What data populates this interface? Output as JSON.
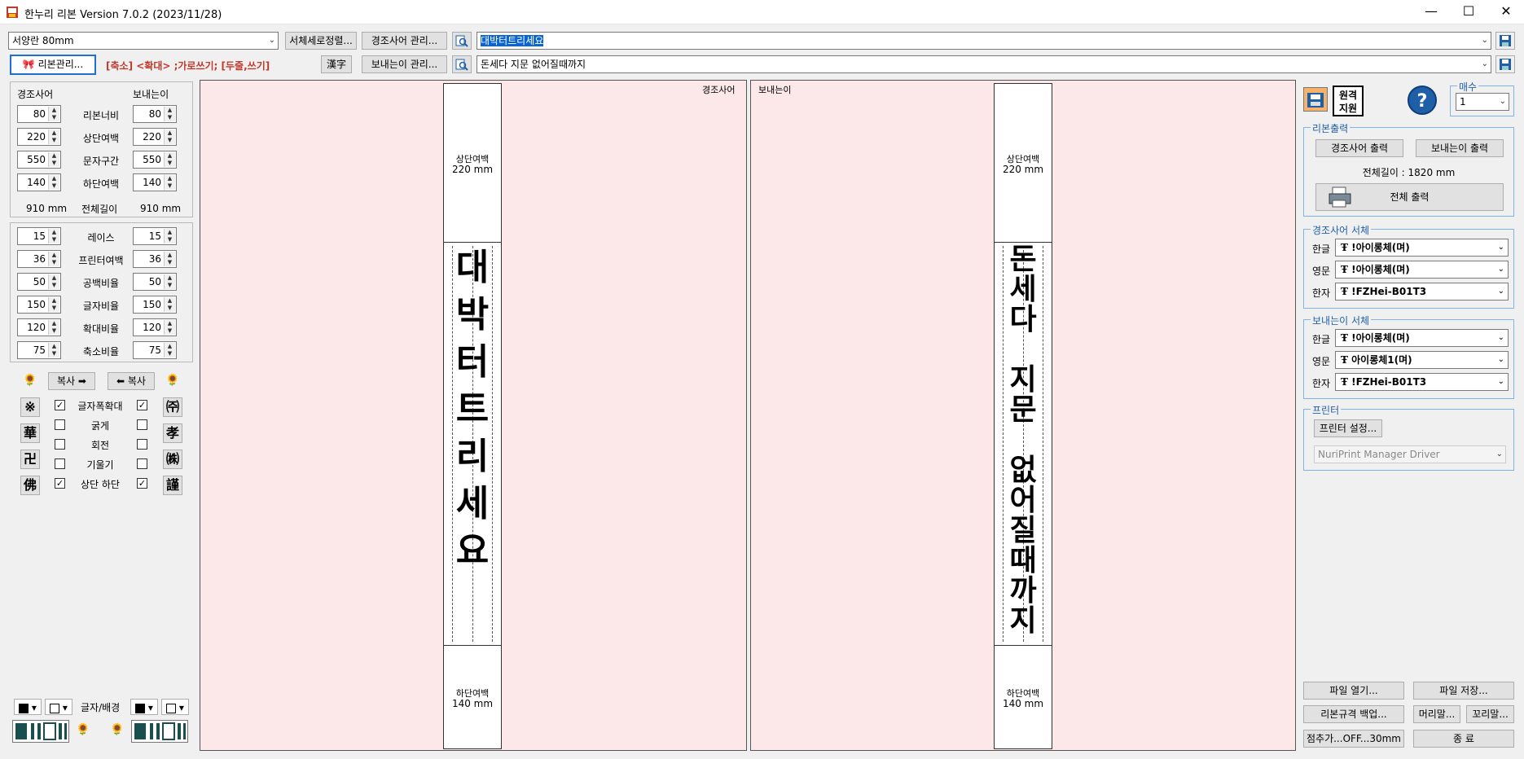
{
  "window": {
    "title": "한누리 리본 Version 7.0.2 (2023/11/28)",
    "min": "—",
    "max": "☐",
    "close": "✕"
  },
  "toolbar": {
    "paper_select": "서양란 80mm",
    "font_sort_btn": "서체세로정렬...",
    "sender_mgr_btn": "경조사어 관리...",
    "receiver_mgr_btn": "보내는이 관리...",
    "ribbon_mgr_btn": "리본관리...",
    "hint": "[축소] <확대> ;가로쓰기; [두줄,쓰기]",
    "hanja_btn": "漢字",
    "sender_text": "대박터트리세요",
    "receiver_text": "돈세다 지문 없어질때까지"
  },
  "left": {
    "col_left": "경조사어",
    "col_right": "보내는이",
    "rows1": [
      {
        "label": "리본너비",
        "l": "80",
        "r": "80"
      },
      {
        "label": "상단여백",
        "l": "220",
        "r": "220"
      },
      {
        "label": "문자구간",
        "l": "550",
        "r": "550"
      },
      {
        "label": "하단여백",
        "l": "140",
        "r": "140"
      }
    ],
    "total_label": "전체길이",
    "total_l": "910 mm",
    "total_r": "910 mm",
    "rows2": [
      {
        "label": "레이스",
        "l": "15",
        "r": "15"
      },
      {
        "label": "프린터여백",
        "l": "36",
        "r": "36"
      },
      {
        "label": "공백비율",
        "l": "50",
        "r": "50"
      },
      {
        "label": "글자비율",
        "l": "150",
        "r": "150"
      },
      {
        "label": "확대비율",
        "l": "120",
        "r": "120"
      },
      {
        "label": "축소비율",
        "l": "75",
        "r": "75"
      }
    ],
    "copy_right": "복사",
    "copy_left": "복사",
    "checks": [
      {
        "label": "글자폭확대",
        "l": true,
        "r": true
      },
      {
        "label": "굵게",
        "l": false,
        "r": false
      },
      {
        "label": "회전",
        "l": false,
        "r": false
      },
      {
        "label": "기울기",
        "l": false,
        "r": false
      },
      {
        "label": "상단 하단",
        "l": true,
        "r": true
      }
    ],
    "sym_left": [
      "※",
      "華",
      "卍",
      "佛"
    ],
    "sym_right": [
      "㈜",
      "孝",
      "㈱",
      "謹"
    ],
    "color_label": "글자/배경"
  },
  "canvas": {
    "left_tag": "경조사어",
    "right_tag": "보내는이",
    "top_label": "상단여백",
    "top_value": "220 mm",
    "bottom_label": "하단여백",
    "bottom_value": "140 mm",
    "left_chars": [
      "대",
      "박",
      "터",
      "트",
      "리",
      "세",
      "요"
    ],
    "right_chars": [
      "돈",
      "세",
      "다",
      "",
      "지",
      "문",
      "",
      "없",
      "어",
      "질",
      "때",
      "까",
      "지"
    ]
  },
  "right": {
    "remote": "원격\n지원",
    "copies_title": "매수",
    "copies_value": "1",
    "print_group": "리본출력",
    "print_sender": "경조사어 출력",
    "print_receiver": "보내는이 출력",
    "total_length": "전체길이 : 1820 mm",
    "print_all": "전체 출력",
    "sender_font_group": "경조사어 서체",
    "receiver_font_group": "보내는이 서체",
    "font_rows_sender": [
      {
        "label": "한글",
        "font": "!아이롱체(며)"
      },
      {
        "label": "영문",
        "font": "!아이롱체(며)"
      },
      {
        "label": "한자",
        "font": "!FZHei-B01T3"
      }
    ],
    "font_rows_receiver": [
      {
        "label": "한글",
        "font": "!아이롱체(며)"
      },
      {
        "label": "영문",
        "font": "아이롱체1(며)"
      },
      {
        "label": "한자",
        "font": "!FZHei-B01T3"
      }
    ],
    "printer_group": "프린터",
    "printer_setup": "프린터 설정...",
    "printer_name": "NuriPrint Manager Driver",
    "open_file": "파일 열기...",
    "save_file": "파일 저장...",
    "backup": "리본규격 백업...",
    "head": "머리말...",
    "tail": "꼬리말...",
    "dot": "점추가...OFF...30mm",
    "exit": "종 료"
  }
}
